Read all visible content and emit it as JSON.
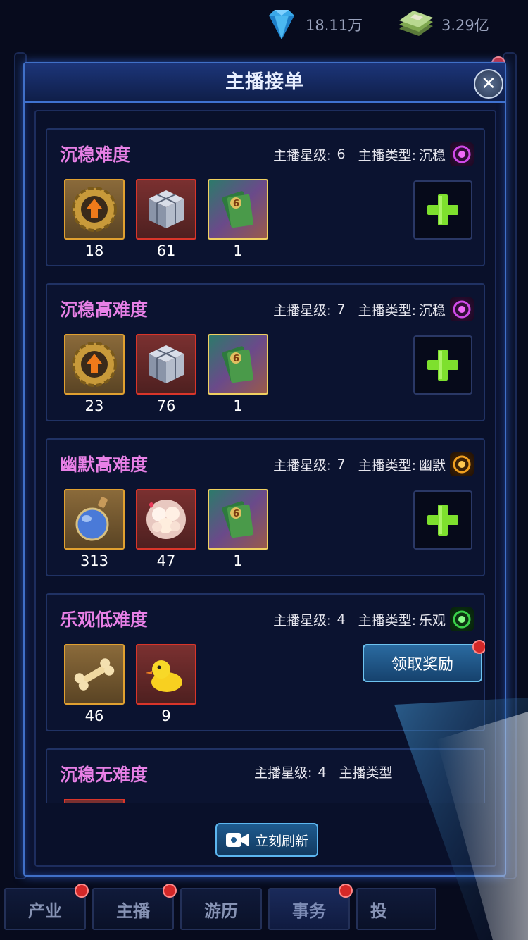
{
  "currencies": {
    "diamond": {
      "icon": "diamond-icon",
      "amount": "18.11万"
    },
    "cash": {
      "icon": "cash-stack-icon",
      "amount": "3.29亿"
    }
  },
  "modal": {
    "title": "主播接单",
    "close_icon": "close-icon"
  },
  "labels": {
    "star_level": "主播星级:",
    "anchor_type": "主播类型:"
  },
  "orders": [
    {
      "title": "沉稳难度",
      "star_level": "6",
      "type": "沉稳",
      "type_color": "#c23ae0",
      "items": [
        {
          "icon": "gear-upgrade-icon",
          "qty": "18",
          "frame": "gold"
        },
        {
          "icon": "metal-cube-icon",
          "qty": "61",
          "frame": "red"
        },
        {
          "icon": "cards-icon",
          "qty": "1",
          "frame": "rainbow"
        }
      ],
      "action": "plus"
    },
    {
      "title": "沉稳高难度",
      "star_level": "7",
      "type": "沉稳",
      "type_color": "#c23ae0",
      "items": [
        {
          "icon": "gear-upgrade-icon",
          "qty": "23",
          "frame": "gold"
        },
        {
          "icon": "metal-cube-icon",
          "qty": "76",
          "frame": "red"
        },
        {
          "icon": "cards-icon",
          "qty": "1",
          "frame": "rainbow"
        }
      ],
      "action": "plus"
    },
    {
      "title": "幽默高难度",
      "star_level": "7",
      "type": "幽默",
      "type_color": "#e89a18",
      "items": [
        {
          "icon": "potion-bottle-icon",
          "qty": "313",
          "frame": "gold"
        },
        {
          "icon": "flower-bouquet-icon",
          "qty": "47",
          "frame": "red"
        },
        {
          "icon": "cards-icon",
          "qty": "1",
          "frame": "rainbow"
        }
      ],
      "action": "plus"
    },
    {
      "title": "乐观低难度",
      "star_level": "4",
      "type": "乐观",
      "type_color": "#3ac24a",
      "items": [
        {
          "icon": "bone-icon",
          "qty": "46",
          "frame": "gold"
        },
        {
          "icon": "rubber-duck-icon",
          "qty": "9",
          "frame": "red"
        }
      ],
      "action": "claim",
      "claim_label": "领取奖励"
    },
    {
      "title": "沉稳无难度",
      "star_level": "4",
      "type_partial": "主播类型",
      "items": []
    }
  ],
  "refresh_label": "立刻刷新",
  "nav": [
    {
      "label": "产业",
      "dot": true
    },
    {
      "label": "主播",
      "dot": true
    },
    {
      "label": "游历",
      "dot": false
    },
    {
      "label": "事务",
      "dot": true,
      "active": true
    },
    {
      "label": "投",
      "dot": false
    }
  ]
}
